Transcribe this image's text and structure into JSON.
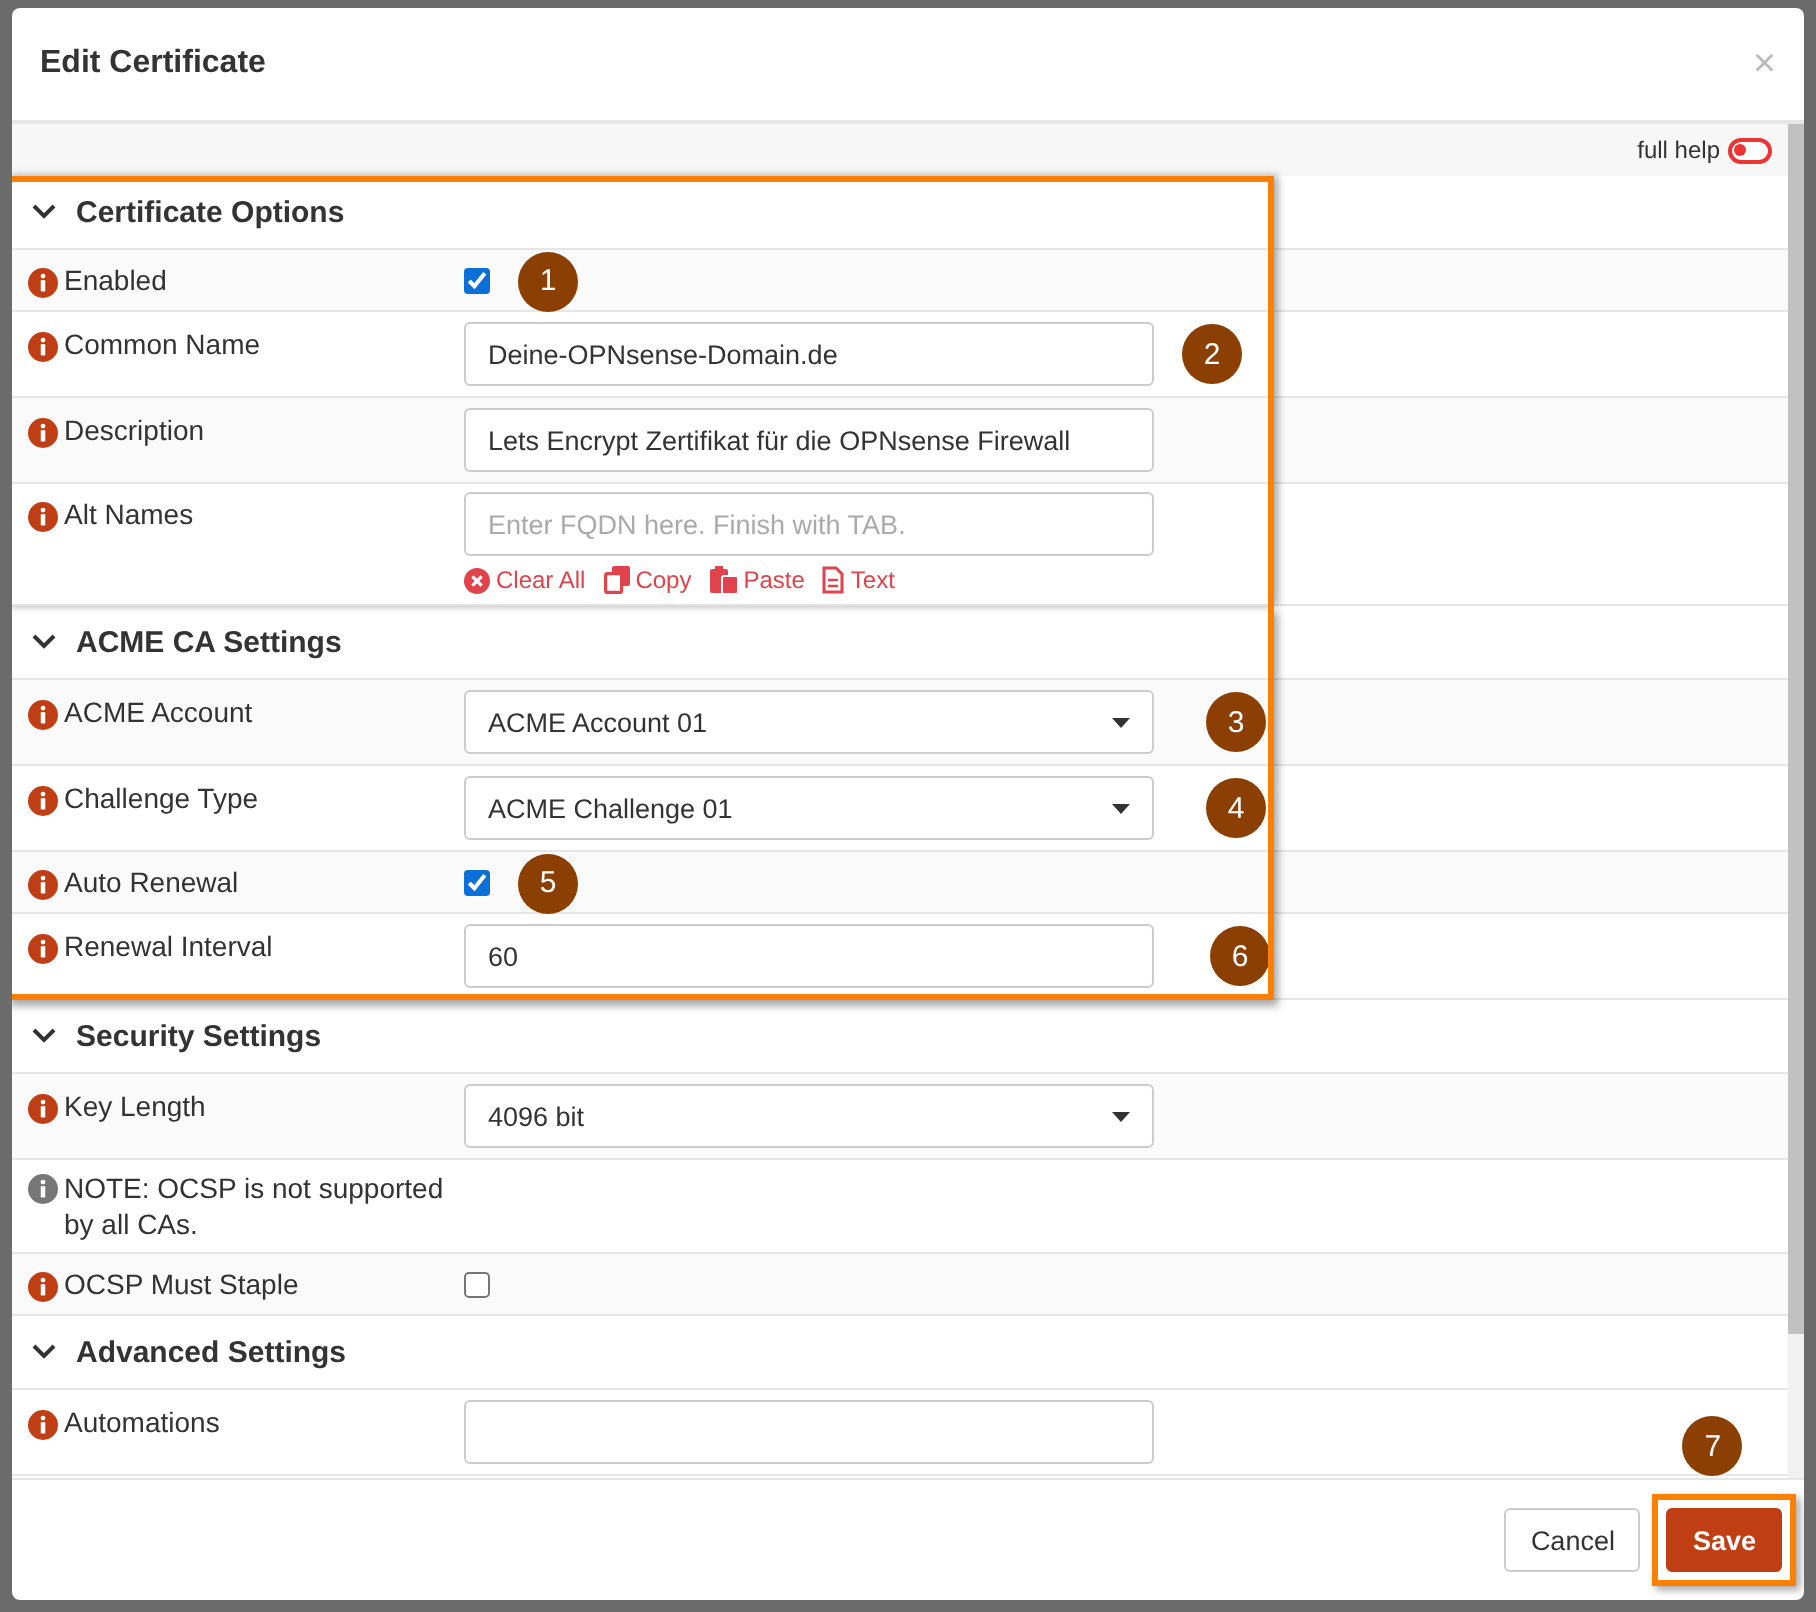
{
  "dialog": {
    "title": "Edit Certificate",
    "close": "×"
  },
  "help_toggle": {
    "label": "full help",
    "on": false
  },
  "sections": [
    {
      "title": "Certificate Options",
      "expanded": true,
      "highlighted": true,
      "rows": [
        {
          "kind": "checkbox",
          "label": "Enabled",
          "checked": true,
          "badge": "1"
        },
        {
          "kind": "text",
          "label": "Common Name",
          "value": "Deine-OPNsense-Domain.de",
          "badge": "2"
        },
        {
          "kind": "text",
          "label": "Description",
          "value": "Lets Encrypt Zertifikat für die OPNsense Firewall"
        },
        {
          "kind": "tags",
          "label": "Alt Names",
          "placeholder": "Enter FQDN here. Finish with TAB.",
          "actions": [
            {
              "kind": "clear",
              "label": "Clear All"
            },
            {
              "kind": "copy",
              "label": "Copy"
            },
            {
              "kind": "paste",
              "label": "Paste"
            },
            {
              "kind": "text",
              "label": "Text"
            }
          ]
        }
      ]
    },
    {
      "title": "ACME CA Settings",
      "expanded": true,
      "highlighted": true,
      "rows": [
        {
          "kind": "select",
          "label": "ACME Account",
          "value": "ACME Account 01",
          "badge": "3"
        },
        {
          "kind": "select",
          "label": "Challenge Type",
          "value": "ACME Challenge 01",
          "badge": "4"
        },
        {
          "kind": "checkbox",
          "label": "Auto Renewal",
          "checked": true,
          "badge": "5"
        },
        {
          "kind": "text",
          "label": "Renewal Interval",
          "value": "60",
          "badge": "6"
        }
      ]
    },
    {
      "title": "Security Settings",
      "expanded": true,
      "highlighted": false,
      "rows": [
        {
          "kind": "select",
          "label": "Key Length",
          "value": "4096 bit"
        },
        {
          "kind": "note",
          "label": "NOTE: OCSP is not supported by all CAs."
        },
        {
          "kind": "checkbox",
          "label": "OCSP Must Staple",
          "checked": false
        }
      ]
    },
    {
      "title": "Advanced Settings",
      "expanded": true,
      "highlighted": false,
      "rows": [
        {
          "kind": "text",
          "label": "Automations",
          "value": ""
        }
      ]
    }
  ],
  "buttons": [
    {
      "kind": "default",
      "label": "Cancel",
      "highlighted": false
    },
    {
      "kind": "primary",
      "label": "Save",
      "highlighted": true,
      "badge": "7"
    }
  ]
}
